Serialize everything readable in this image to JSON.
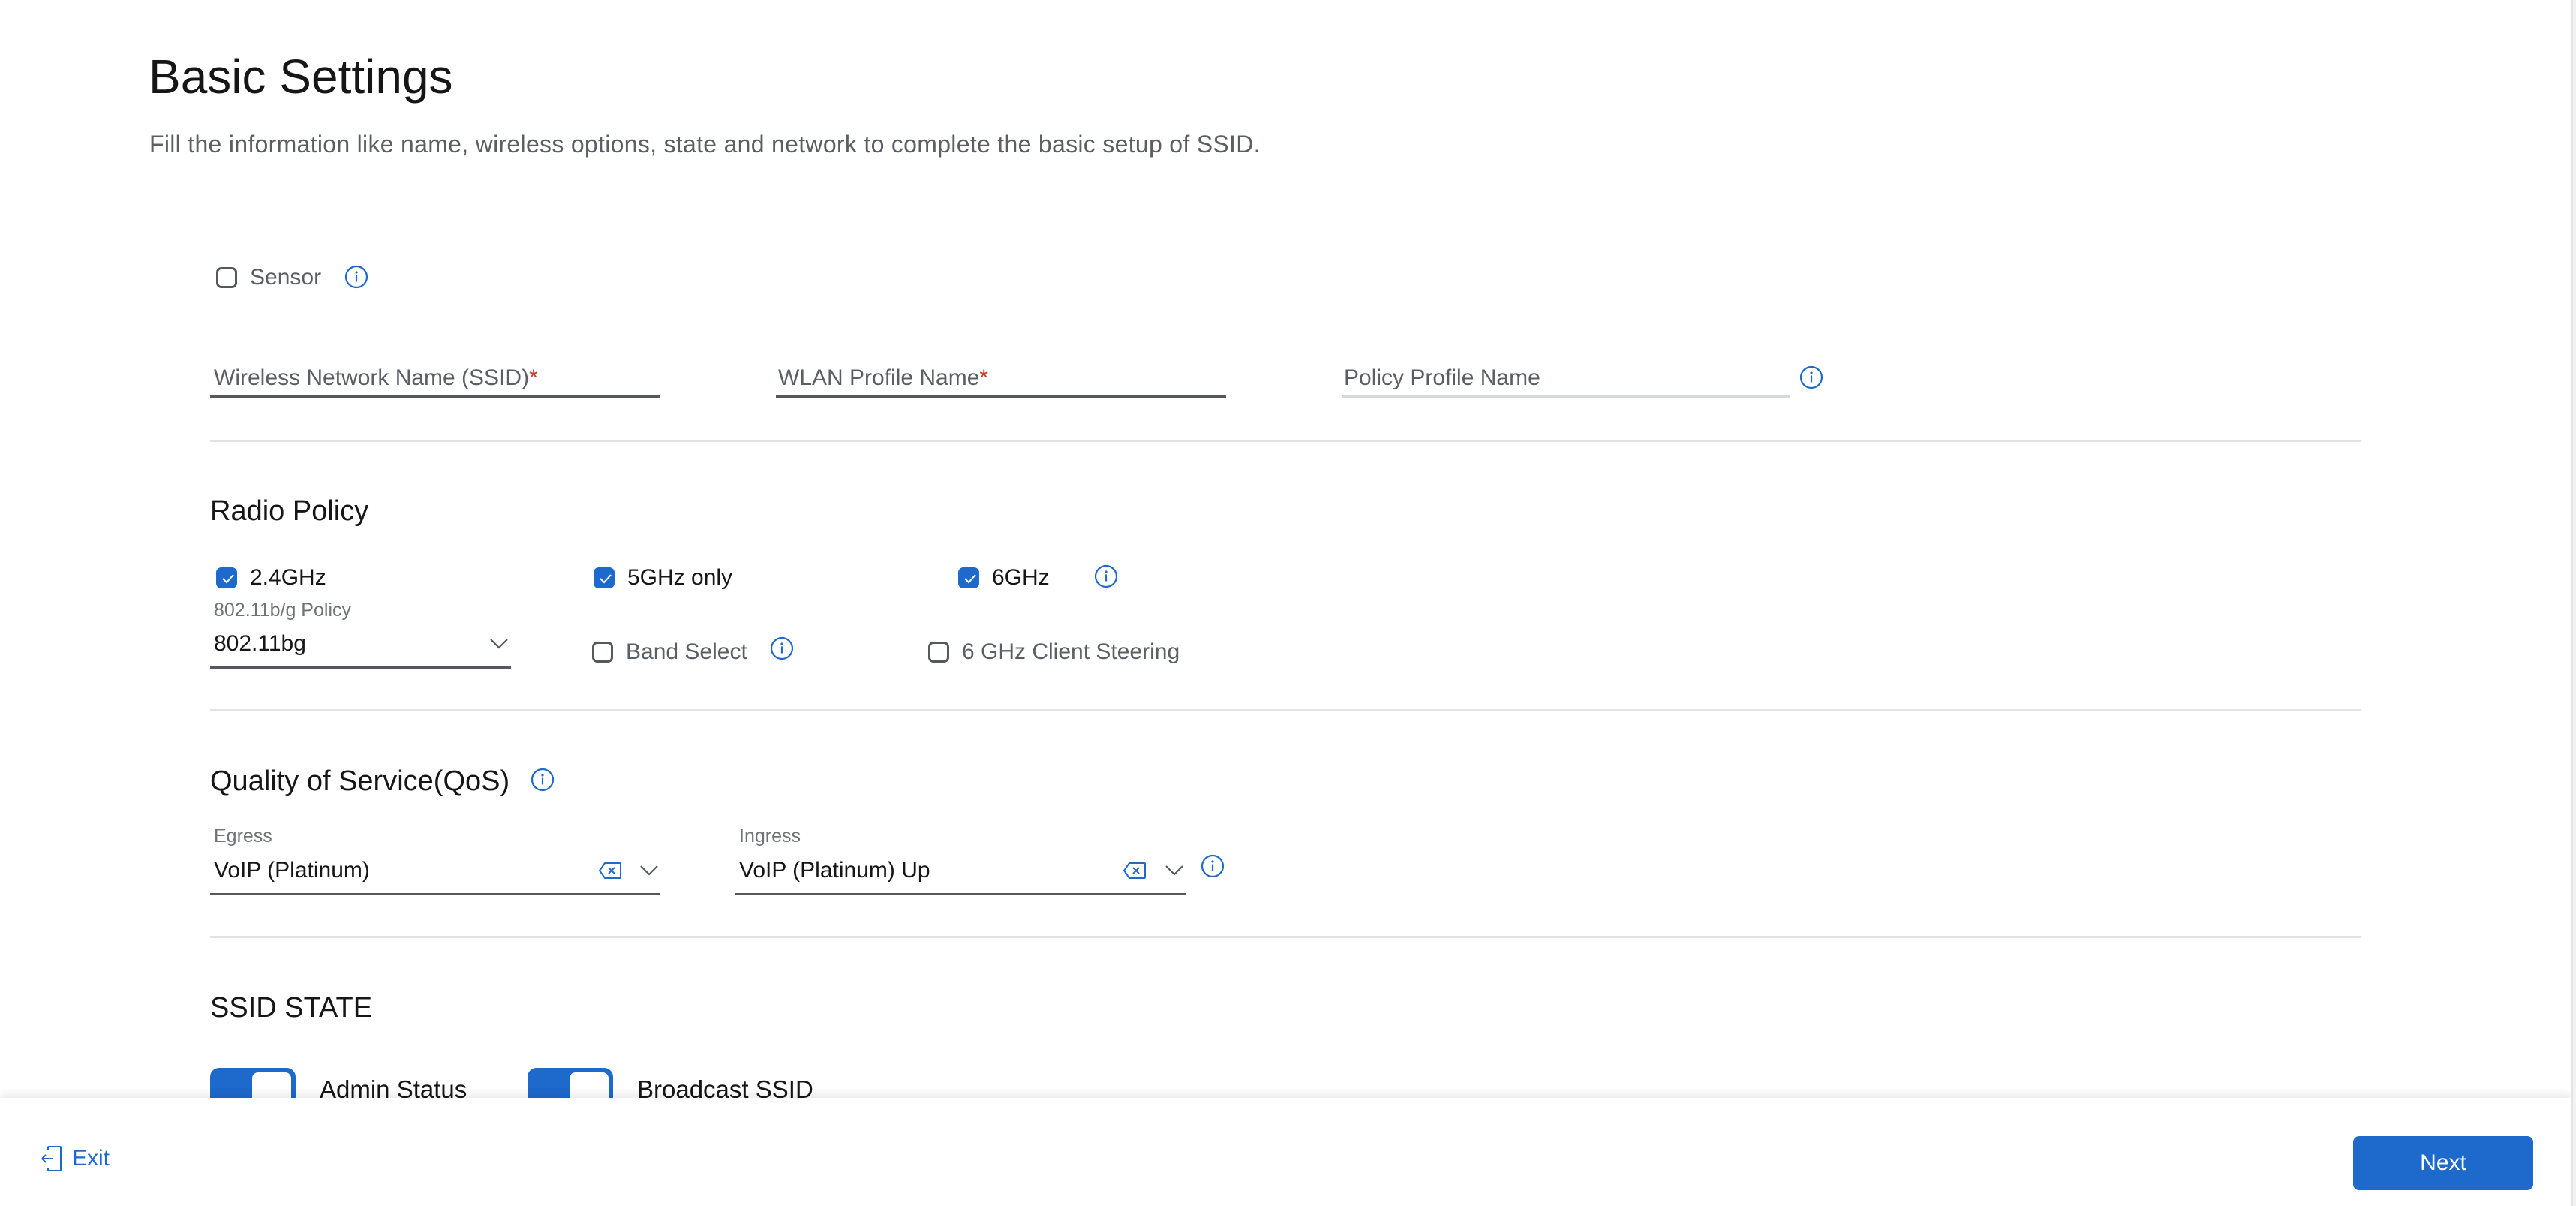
{
  "page": {
    "title": "Basic Settings",
    "subtitle": "Fill the information like name, wireless options, state and network to complete the basic setup of SSID."
  },
  "sensor": {
    "label": "Sensor",
    "checked": false,
    "info_icon": "info-icon"
  },
  "name_fields": {
    "ssid": {
      "placeholder": "Wireless Network Name (SSID)",
      "required_mark": "*",
      "value": ""
    },
    "wlan_profile": {
      "placeholder": "WLAN Profile Name",
      "required_mark": "*",
      "value": ""
    },
    "policy_profile": {
      "placeholder": "Policy Profile Name",
      "value": "",
      "disabled": true,
      "info_icon": "info-icon"
    }
  },
  "radio_policy": {
    "title": "Radio Policy",
    "band_24": {
      "label": "2.4GHz",
      "checked": true
    },
    "band_5": {
      "label": "5GHz only",
      "checked": true
    },
    "band_6": {
      "label": "6GHz",
      "checked": true,
      "info_icon": "info-icon"
    },
    "policy_select": {
      "label": "802.11b/g Policy",
      "value": "802.11bg",
      "icon": "chevron-down-icon"
    },
    "band_select": {
      "label": "Band Select",
      "checked": false,
      "info_icon": "info-icon"
    },
    "client_steering": {
      "label": "6 GHz Client Steering",
      "checked": false
    }
  },
  "qos": {
    "title": "Quality of Service(QoS)",
    "info_icon": "info-icon",
    "egress": {
      "label": "Egress",
      "value": "VoIP (Platinum)",
      "clear_icon": "clear-icon",
      "icon": "chevron-down-icon"
    },
    "ingress": {
      "label": "Ingress",
      "value": "VoIP (Platinum) Up",
      "clear_icon": "clear-icon",
      "icon": "chevron-down-icon",
      "info_icon": "info-icon"
    }
  },
  "ssid_state": {
    "title": "SSID STATE",
    "admin_status": {
      "label": "Admin Status",
      "on": true
    },
    "broadcast_ssid": {
      "label": "Broadcast SSID",
      "on": true
    }
  },
  "footer": {
    "exit_label": "Exit",
    "exit_icon": "exit-icon",
    "next_label": "Next"
  },
  "colors": {
    "accent": "#1d69cc",
    "required": "#c0392b",
    "text": "#161616",
    "muted": "#5b5f63"
  }
}
